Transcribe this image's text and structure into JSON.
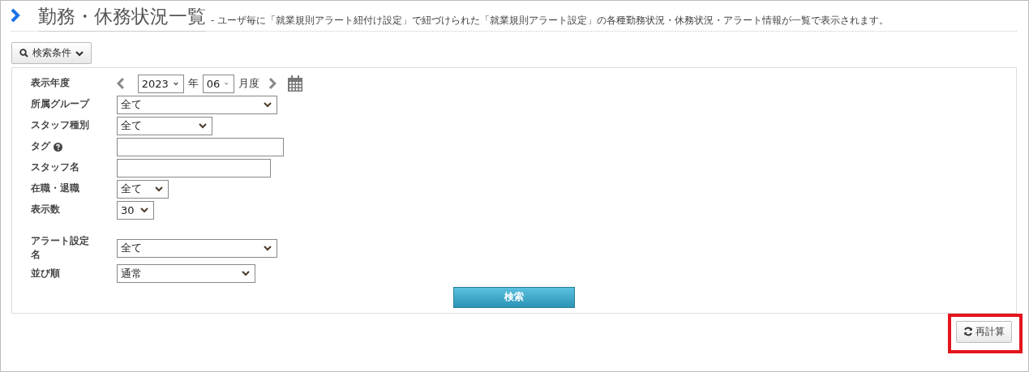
{
  "header": {
    "title": "勤務・休務状況一覧",
    "description": "- ユーザ毎に「就業規則アラート紐付け設定」で紐づけられた「就業規則アラート設定」の各種勤務状況・休務状況・アラート情報が一覧で表示されます。"
  },
  "search_toggle": {
    "label": "検索条件",
    "expanded": true
  },
  "filters": [
    {
      "kind": "period",
      "label": "表示年度",
      "year": "2023",
      "year_unit": "年",
      "month": "06",
      "month_unit": "月度"
    },
    {
      "kind": "select",
      "label": "所属グループ",
      "value": "全て"
    },
    {
      "kind": "select",
      "label": "スタッフ種別",
      "value": "全て"
    },
    {
      "kind": "text",
      "label": "タグ",
      "help": true
    },
    {
      "kind": "text",
      "label": "スタッフ名"
    },
    {
      "kind": "select",
      "label": "在職・退職",
      "value": "全て"
    },
    {
      "kind": "select",
      "label": "表示数",
      "value": "30"
    }
  ],
  "alert_filters": [
    {
      "kind": "select",
      "label": "アラート設定名",
      "value": "全て"
    },
    {
      "kind": "select",
      "label": "並び順",
      "value": "通常"
    }
  ],
  "search_button": "検索",
  "recalc_button": {
    "label": "再計算",
    "highlighted": true
  }
}
